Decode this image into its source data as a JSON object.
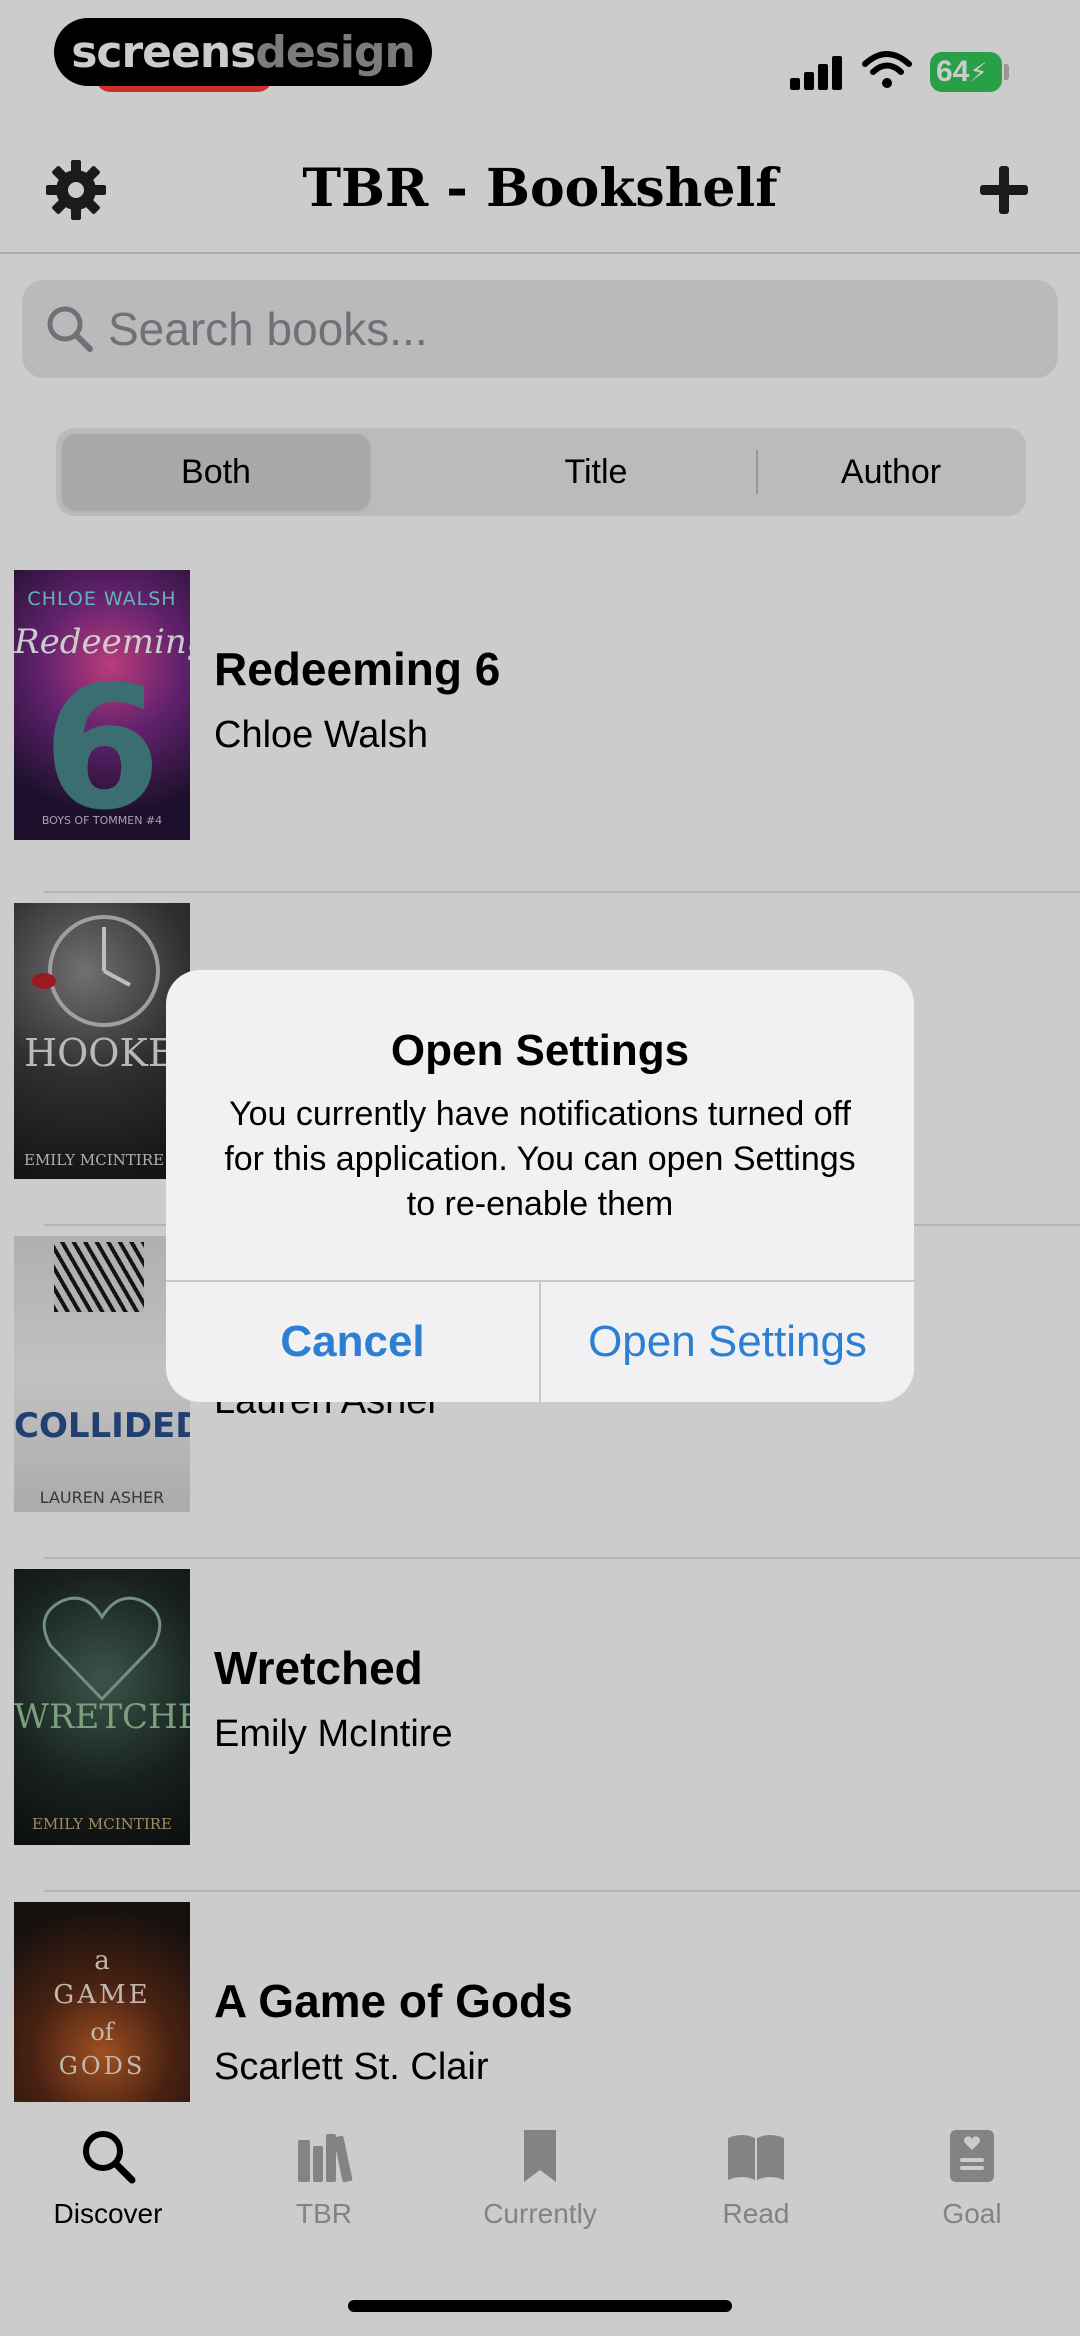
{
  "status_bar": {
    "watermark_part1": "screens",
    "watermark_part2": "design",
    "battery": "64"
  },
  "header": {
    "title": "TBR - Bookshelf",
    "settings_icon": "gear-icon",
    "add_icon": "plus-icon"
  },
  "search": {
    "placeholder": "Search books...",
    "value": ""
  },
  "filter": {
    "options": [
      "Both",
      "Title",
      "Author"
    ],
    "selected": "Both"
  },
  "books": [
    {
      "title": "Redeeming 6",
      "author": "Chloe Walsh",
      "cover": {
        "top": "CHLOE WALSH",
        "script": "Redeeming",
        "big": "6",
        "bottom": "BOYS OF TOMMEN #4"
      }
    },
    {
      "title": "",
      "author": "",
      "cover": {
        "big": "HOOKED",
        "bottom": "EMILY MCINTIRE"
      }
    },
    {
      "title": "",
      "author": "Lauren Asher",
      "cover": {
        "big": "COLLIDED",
        "bottom": "LAUREN ASHER"
      }
    },
    {
      "title": "Wretched",
      "author": "Emily McIntire",
      "cover": {
        "big": "WRETCHED",
        "bottom": "EMILY MCINTIRE"
      }
    },
    {
      "title": "A Game of Gods",
      "author": "Scarlett St. Clair",
      "cover": {
        "line1": "a",
        "line2": "GAME",
        "line3": "of",
        "line4": "GODS"
      }
    }
  ],
  "tabs": [
    {
      "label": "Discover",
      "icon": "search-icon",
      "active": true
    },
    {
      "label": "TBR",
      "icon": "books-icon",
      "active": false
    },
    {
      "label": "Currently",
      "icon": "bookmark-icon",
      "active": false
    },
    {
      "label": "Read",
      "icon": "open-book-icon",
      "active": false
    },
    {
      "label": "Goal",
      "icon": "goal-book-icon",
      "active": false
    }
  ],
  "alert": {
    "title": "Open Settings",
    "message": "You currently have notifications turned off for this application. You can open Settings to re-enable them",
    "cancel_label": "Cancel",
    "confirm_label": "Open Settings"
  },
  "colors": {
    "accent": "#2d7fd3",
    "battery": "#34c759",
    "tab_inactive": "#a4a4a8"
  }
}
